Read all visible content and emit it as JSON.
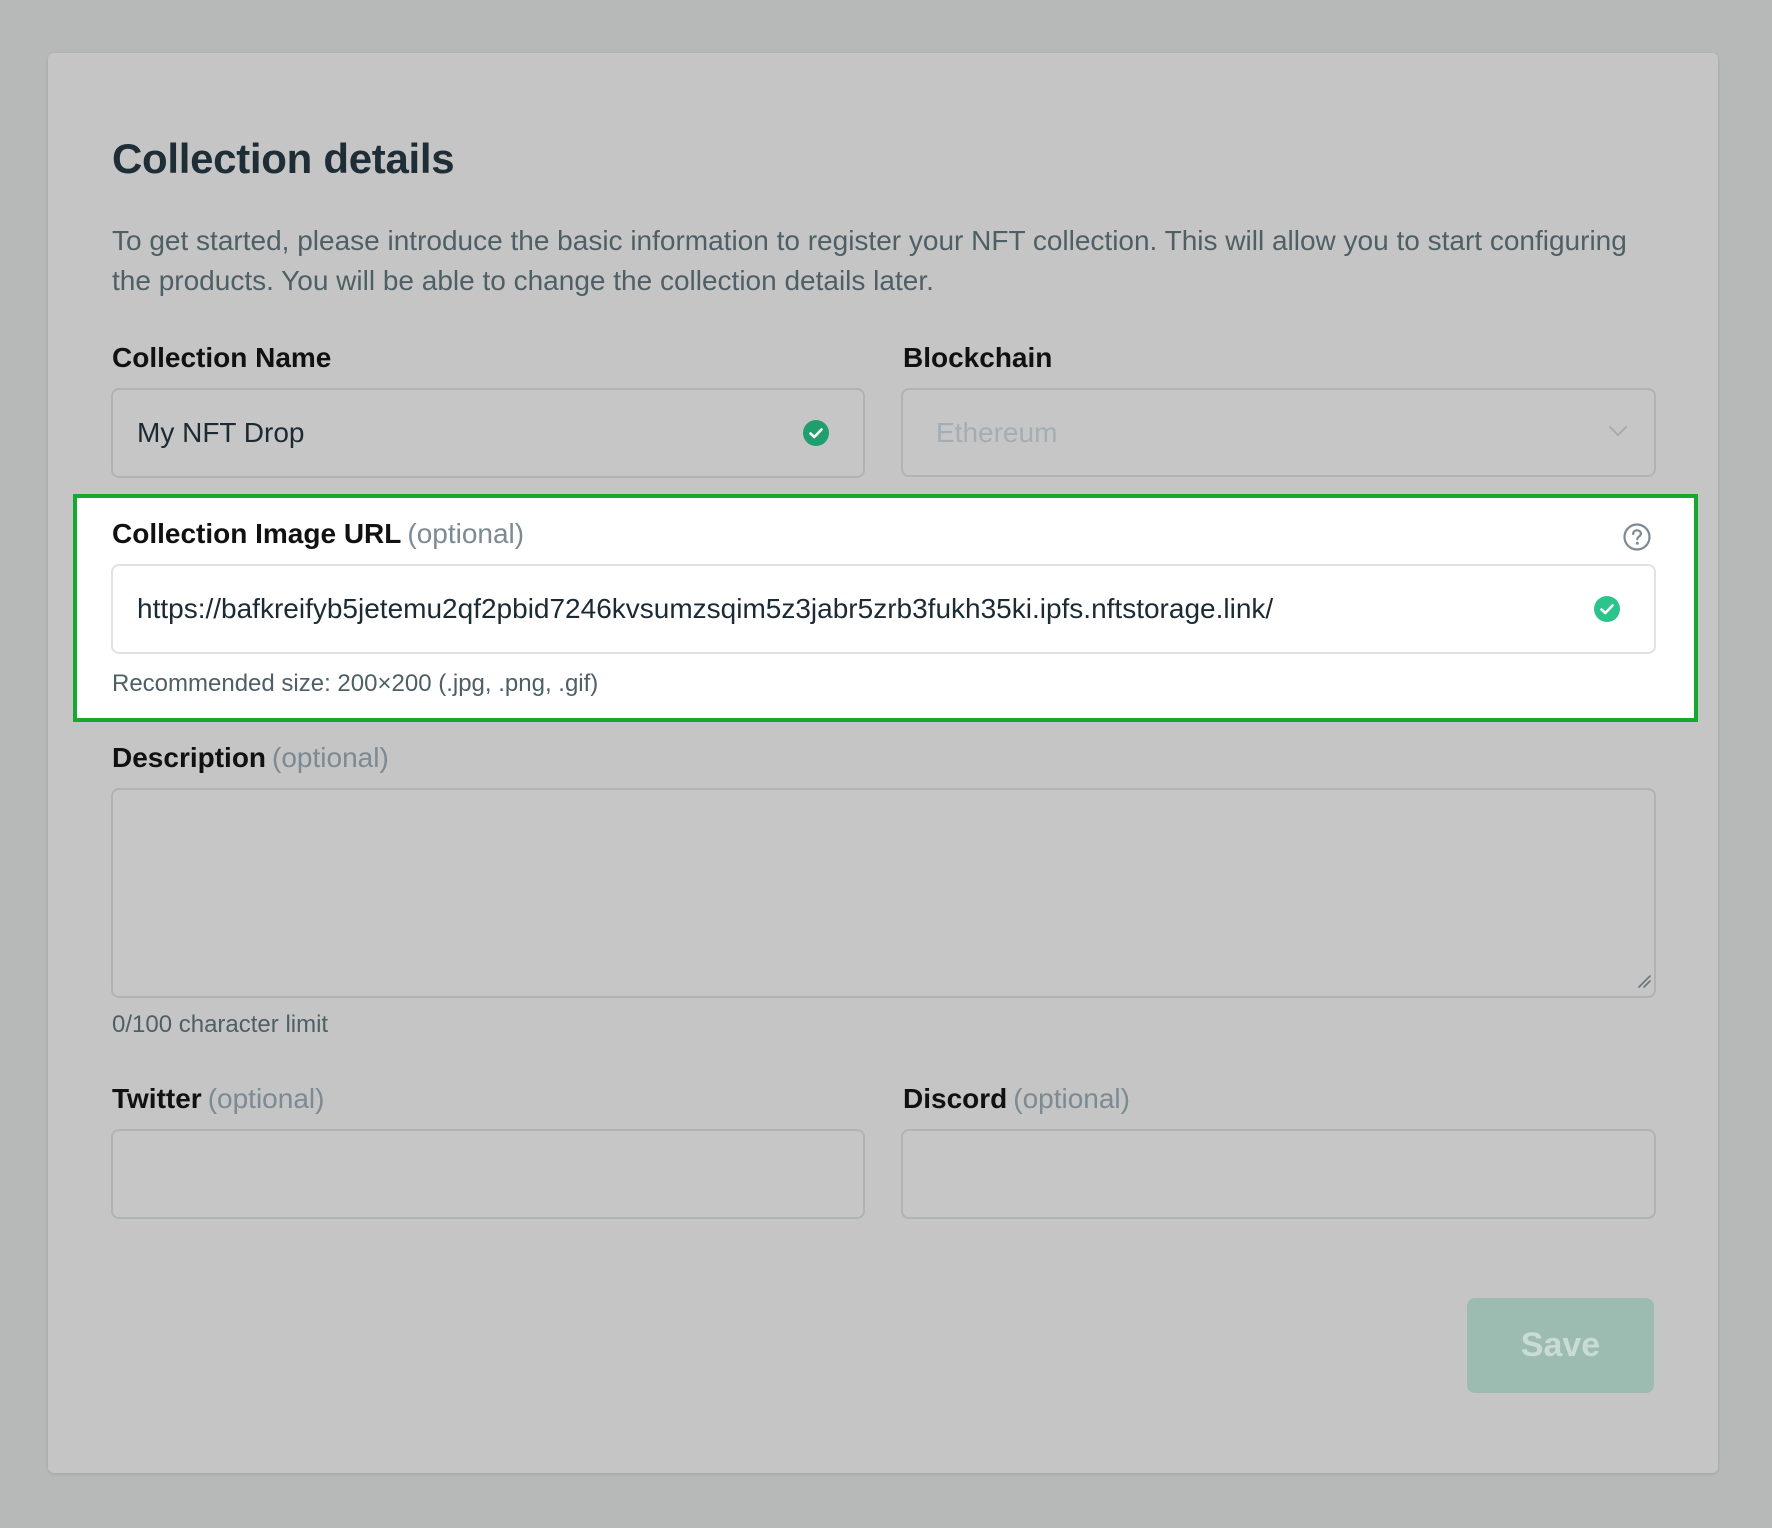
{
  "header": {
    "title": "Collection details",
    "intro": "To get started, please introduce the basic information to register your NFT collection. This will allow you to start configuring the products. You will be able to change the collection details later."
  },
  "collection_name": {
    "label": "Collection Name",
    "value": "My NFT Drop",
    "status_icon": "check-circle-icon"
  },
  "blockchain": {
    "label": "Blockchain",
    "selected": "Ethereum",
    "icon": "chevron-down-icon"
  },
  "image_url": {
    "label": "Collection Image URL",
    "optional": "(optional)",
    "value": "https://bafkreifyb5jetemu2qf2pbid7246kvsumzsqim5z3jabr5zrb3fukh35ki.ipfs.nftstorage.link/",
    "hint": "Recommended size: 200×200 (.jpg, .png, .gif)",
    "help_icon": "question-circle-icon",
    "status_icon": "check-circle-icon"
  },
  "description": {
    "label": "Description",
    "optional": "(optional)",
    "value": "",
    "counter": "0/100 character limit"
  },
  "twitter": {
    "label": "Twitter",
    "optional": "(optional)",
    "value": ""
  },
  "discord": {
    "label": "Discord",
    "optional": "(optional)",
    "value": ""
  },
  "actions": {
    "save_label": "Save"
  },
  "colors": {
    "backdrop": "#b7b9b9",
    "card": "#c5c5c5",
    "highlight_border": "#16a82f",
    "check_green": "#1f9e6e",
    "check_green_active": "#2bc48a",
    "save_button": "#9dbcb1"
  }
}
